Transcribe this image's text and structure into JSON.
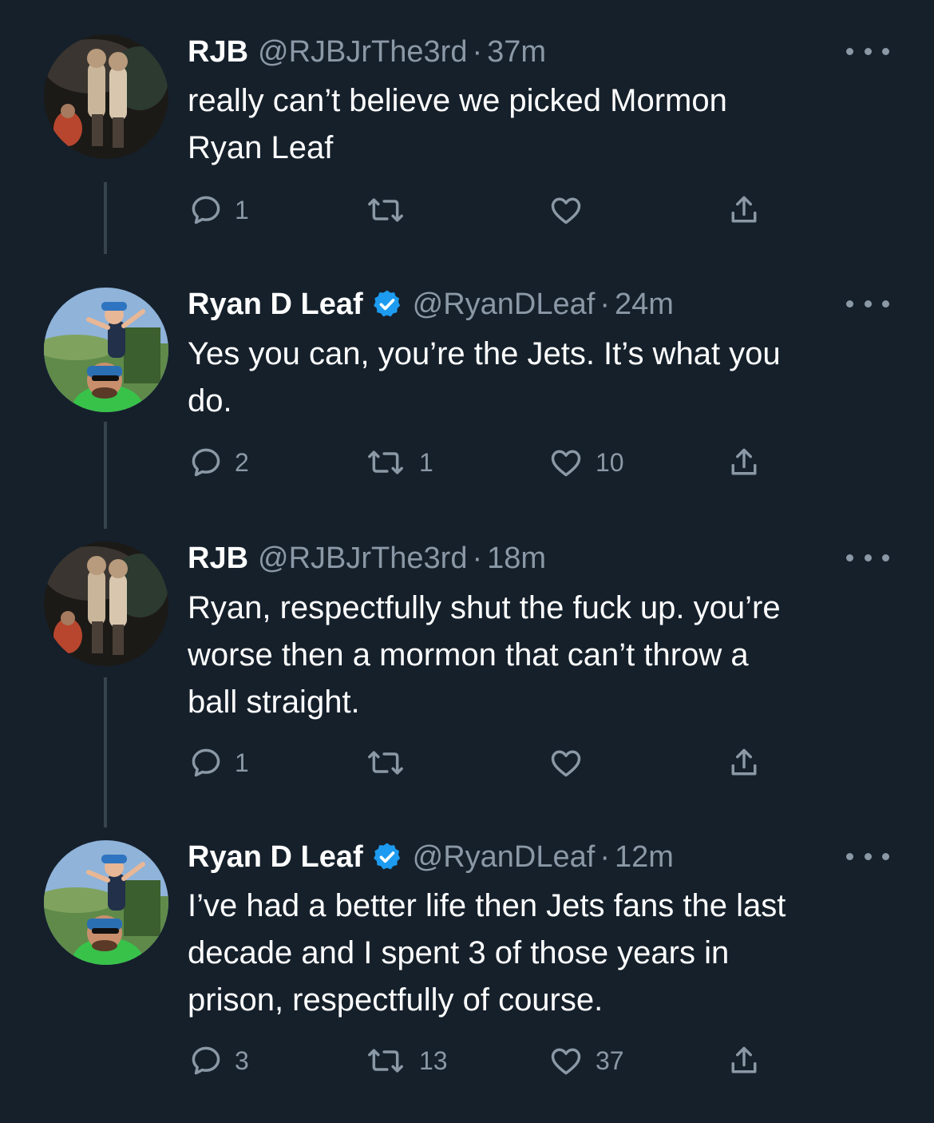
{
  "tweets": [
    {
      "name": "RJB",
      "handle": "@RJBJrThe3rd",
      "dot": "·",
      "time": "37m",
      "verified": false,
      "avatar_icon": "avatar-rjb",
      "lines": [
        "really can’t believe we picked Mormon",
        "Ryan Leaf"
      ],
      "replies": "1",
      "retweets": "",
      "likes": ""
    },
    {
      "name": "Ryan D Leaf",
      "handle": "@RyanDLeaf",
      "dot": "·",
      "time": "24m",
      "verified": true,
      "avatar_icon": "avatar-ryan",
      "lines": [
        "Yes you can, you’re the Jets. It’s what you",
        "do."
      ],
      "replies": "2",
      "retweets": "1",
      "likes": "10"
    },
    {
      "name": "RJB",
      "handle": "@RJBJrThe3rd",
      "dot": "·",
      "time": "18m",
      "verified": false,
      "avatar_icon": "avatar-rjb",
      "lines": [
        "Ryan, respectfully shut the fuck up. you’re",
        "worse then a mormon that can’t throw a",
        "ball straight."
      ],
      "replies": "1",
      "retweets": "",
      "likes": ""
    },
    {
      "name": "Ryan D Leaf",
      "handle": "@RyanDLeaf",
      "dot": "·",
      "time": "12m",
      "verified": true,
      "avatar_icon": "avatar-ryan",
      "lines": [
        "I’ve had a better life then Jets fans the last",
        "decade and I spent 3 of those years in",
        "prison, respectfully of course."
      ],
      "replies": "3",
      "retweets": "13",
      "likes": "37"
    }
  ],
  "colors": {
    "background": "#15202b",
    "text": "#ffffff",
    "secondary": "#8b98a5",
    "verified": "#1d9bf0",
    "thread_line": "#38444d"
  }
}
